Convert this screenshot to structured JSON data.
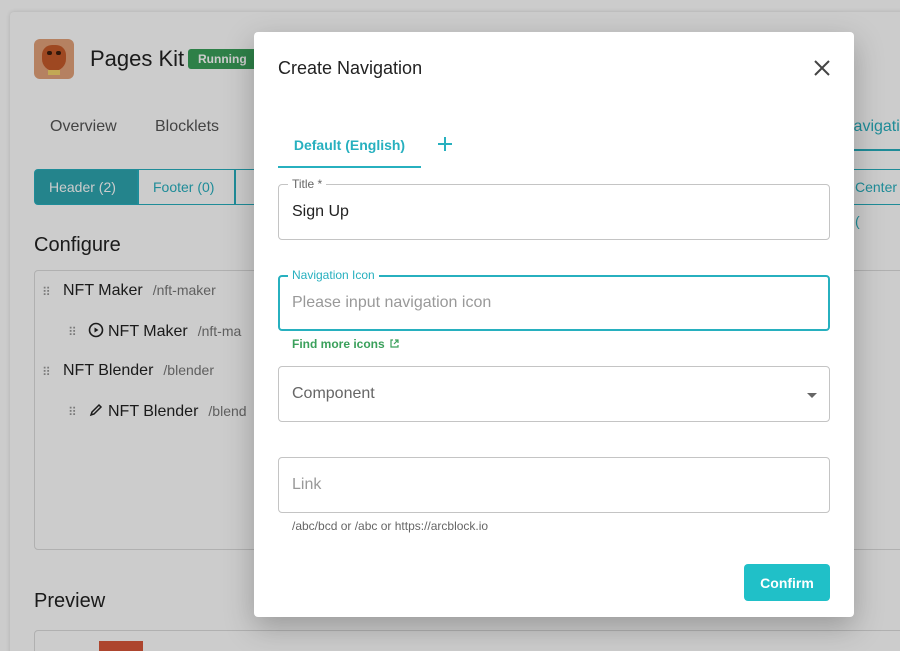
{
  "app": {
    "title": "Pages Kit",
    "status": "Running",
    "tabs": [
      {
        "label": "Overview"
      },
      {
        "label": "Blocklets"
      },
      {
        "label": "Navigation"
      }
    ],
    "segments": [
      {
        "label": "Header (2)"
      },
      {
        "label": "Footer (0)"
      },
      {
        "label": "Center ("
      }
    ]
  },
  "configure": {
    "heading": "Configure",
    "items": [
      {
        "title": "NFT Maker",
        "path": "/nft-maker"
      },
      {
        "title": "NFT Maker",
        "path": "/nft-ma",
        "icon": "play-circle-icon"
      },
      {
        "title": "NFT Blender",
        "path": "/blender"
      },
      {
        "title": "NFT Blender",
        "path": "/blend",
        "icon": "pencil-icon"
      }
    ]
  },
  "preview": {
    "heading": "Preview"
  },
  "dialog": {
    "title": "Create Navigation",
    "lang_tab": "Default (English)",
    "title_field": {
      "label": "Title *",
      "value": "Sign Up"
    },
    "icon_field": {
      "label": "Navigation Icon",
      "placeholder": "Please input navigation icon"
    },
    "find_icons": "Find more icons",
    "component_field": {
      "placeholder": "Component"
    },
    "link_field": {
      "placeholder": "Link"
    },
    "link_helper": "/abc/bcd or /abc or https://arcblock.io",
    "confirm": "Confirm"
  },
  "colors": {
    "accent": "#27b0bf",
    "success": "#3aa05b",
    "button": "#20c0c8"
  }
}
